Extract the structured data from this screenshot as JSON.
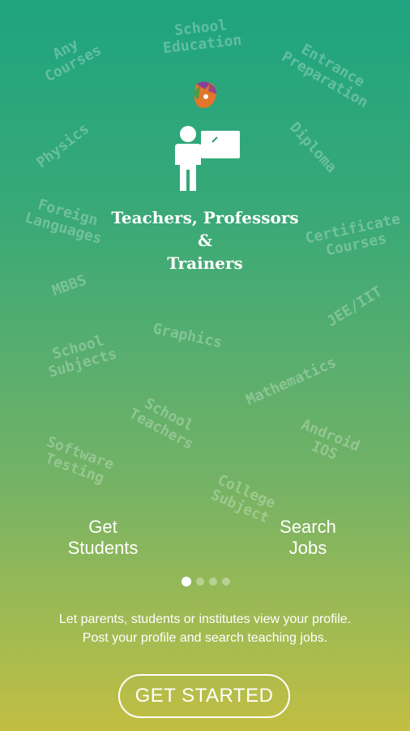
{
  "background_words": [
    {
      "id": "any-courses",
      "text": "Any\nCourses"
    },
    {
      "id": "school-education",
      "text": "School\nEducation"
    },
    {
      "id": "entrance-preparation",
      "text": "Entrance\nPreparation"
    },
    {
      "id": "physics",
      "text": "Physics"
    },
    {
      "id": "diploma",
      "text": "Diploma"
    },
    {
      "id": "foreign-languages",
      "text": "Foreign\nLanguages"
    },
    {
      "id": "certificate-courses",
      "text": "Certificate\nCourses"
    },
    {
      "id": "mbbs",
      "text": "MBBS"
    },
    {
      "id": "jee-iit",
      "text": "JEE/IIT"
    },
    {
      "id": "graphics",
      "text": "Graphics"
    },
    {
      "id": "school-subjects",
      "text": "School\nSubjects"
    },
    {
      "id": "mathematics",
      "text": "Mathematics"
    },
    {
      "id": "school-teachers",
      "text": "School\nTeachers"
    },
    {
      "id": "android-ios",
      "text": "Android\nIOS"
    },
    {
      "id": "software-testing",
      "text": "Software\nTesting"
    },
    {
      "id": "college-subject",
      "text": "College\nSubject"
    }
  ],
  "headline": {
    "line1": "Teachers, Professors",
    "line2": "&",
    "line3": "Trainers"
  },
  "features": {
    "left": {
      "line1": "Get",
      "line2": "Students"
    },
    "right": {
      "line1": "Search",
      "line2": "Jobs"
    }
  },
  "pager": {
    "total": 4,
    "active": 1
  },
  "description": {
    "line1": "Let parents, students or institutes view your profile.",
    "line2": "Post your profile and search teaching jobs."
  },
  "cta": {
    "label": "GET STARTED"
  },
  "colors": {
    "gradient_top": "#1ea47f",
    "gradient_bottom": "#c2be42",
    "logo_orange": "#e2762a",
    "logo_purple": "#8b3f96",
    "logo_green": "#4f9a45"
  }
}
